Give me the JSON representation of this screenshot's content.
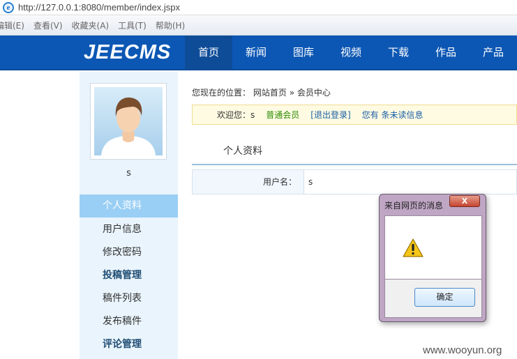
{
  "browser": {
    "url": "http://127.0.0.1:8080/member/index.jspx",
    "menu": [
      "编辑(E)",
      "查看(V)",
      "收藏夹(A)",
      "工具(T)",
      "帮助(H)"
    ]
  },
  "site": {
    "logo": "JEECMS",
    "nav": [
      "首页",
      "新闻",
      "图库",
      "视频",
      "下载",
      "作品",
      "产品"
    ]
  },
  "sidebar": {
    "username": "s",
    "items": [
      {
        "label": "个人资料"
      },
      {
        "label": "用户信息"
      },
      {
        "label": "修改密码"
      },
      {
        "label": "投稿管理"
      },
      {
        "label": "稿件列表"
      },
      {
        "label": "发布稿件"
      },
      {
        "label": "评论管理"
      }
    ]
  },
  "main": {
    "breadcrumb": {
      "prefix": "您现在的位置：",
      "home": "网站首页",
      "sep": "»",
      "current": "会员中心"
    },
    "welcome": {
      "greeting": "欢迎您：s",
      "group": "普通会员",
      "logout": "[退出登录]",
      "messages": "您有 条未读信息"
    },
    "section_title": "个人资料",
    "fields": [
      {
        "label": "用户名：",
        "value": "s"
      }
    ]
  },
  "dialog": {
    "title": "来自网页的消息",
    "close": "X",
    "ok": "确定"
  },
  "watermark": "www.wooyun.org",
  "colors": {
    "header_bg": "#0c57b4",
    "sidebar_bg": "#e9f4fc",
    "sidebar_active": "#9acff5"
  }
}
